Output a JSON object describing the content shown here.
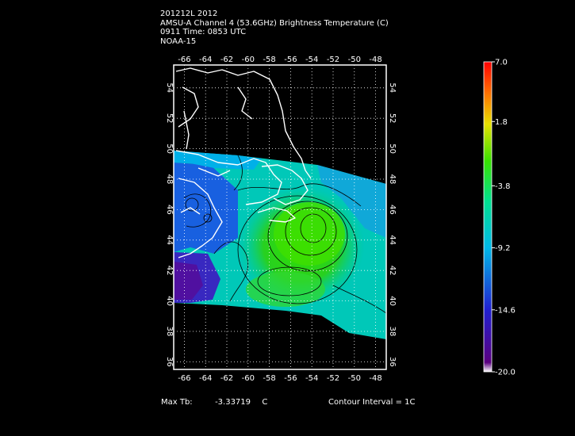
{
  "header": {
    "line1": "201212L 2012",
    "line2": "AMSU-A Channel 4 (53.6GHz) Brightness Temperature (C)",
    "line3": "0911 Time: 0853 UTC",
    "line4": "NOAA-15"
  },
  "map": {
    "lon_labels": [
      "-66",
      "-64",
      "-62",
      "-60",
      "-58",
      "-56",
      "-54",
      "-52",
      "-50",
      "-48"
    ],
    "lat_labels": [
      "54",
      "52",
      "50",
      "48",
      "46",
      "44",
      "42",
      "40",
      "38",
      "36"
    ],
    "lon_range": [
      -67,
      -47
    ],
    "lat_range": [
      35.5,
      55.5
    ],
    "grid": true
  },
  "colorbar": {
    "ticks": [
      "7.0",
      "1.8",
      "-3.8",
      "-9.2",
      "-14.6",
      "-20.0"
    ],
    "range": [
      -20.0,
      7.0
    ],
    "colors": [
      "#ffffff",
      "#5a0080",
      "#2020d0",
      "#00b8e8",
      "#00e090",
      "#38e000",
      "#e8e000",
      "#ff7000",
      "#ff0000"
    ]
  },
  "footer": {
    "max_label": "Max Tb:",
    "max_value": "-3.33719",
    "max_unit": "C",
    "contour_label": "Contour Interval = 1C"
  },
  "colors": {
    "background": "#000000",
    "coast": "#ffffff",
    "frame": "#ffffff"
  }
}
